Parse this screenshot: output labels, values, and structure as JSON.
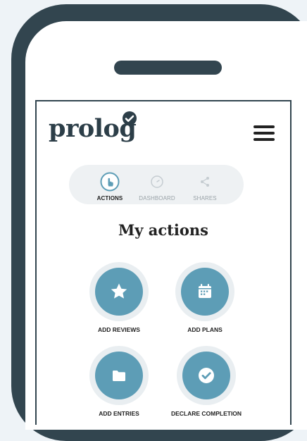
{
  "brand": {
    "logo_text": "prolog"
  },
  "tabs": [
    {
      "label": "ACTIONS",
      "icon": "hand-pointer-icon",
      "active": true
    },
    {
      "label": "DASHBOARD",
      "icon": "gauge-icon",
      "active": false
    },
    {
      "label": "SHARES",
      "icon": "share-icon",
      "active": false
    }
  ],
  "page": {
    "title": "My actions"
  },
  "actions": [
    {
      "label": "ADD REVIEWS",
      "icon": "star-icon"
    },
    {
      "label": "ADD PLANS",
      "icon": "calendar-icon"
    },
    {
      "label": "ADD ENTRIES",
      "icon": "folder-icon"
    },
    {
      "label": "DECLARE COMPLETION",
      "icon": "check-icon"
    }
  ],
  "colors": {
    "accent": "#5d9db6",
    "frame": "#32454f",
    "tab_bg": "#eef1f3"
  }
}
